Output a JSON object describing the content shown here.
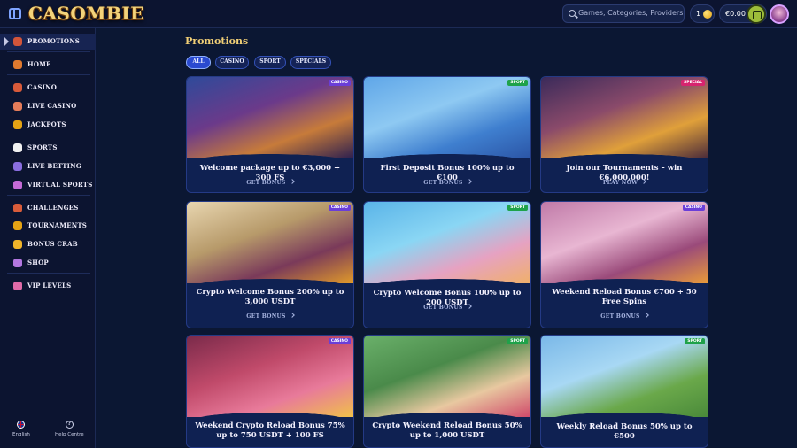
{
  "app": {
    "logo": "CASOMBIE"
  },
  "header": {
    "search_placeholder": "Games, Categories, Providers",
    "coins": "1",
    "balance": "€0.00"
  },
  "sidebar": {
    "items": [
      {
        "label": "PROMOTIONS",
        "icon": "gift-icon",
        "color": "#d2553a"
      },
      {
        "label": "HOME",
        "icon": "home-icon",
        "color": "#e07a2f"
      },
      {
        "label": "CASINO",
        "icon": "casino-icon",
        "color": "#d85a3a"
      },
      {
        "label": "LIVE CASINO",
        "icon": "live-casino-icon",
        "color": "#e47c5a"
      },
      {
        "label": "JACKPOTS",
        "icon": "clover-icon",
        "color": "#e5a314"
      },
      {
        "label": "SPORTS",
        "icon": "ball-icon",
        "color": "#f1f1f1"
      },
      {
        "label": "LIVE BETTING",
        "icon": "live-betting-icon",
        "color": "#8a6ee0"
      },
      {
        "label": "VIRTUAL SPORTS",
        "icon": "gamepad-icon",
        "color": "#c46ad6"
      },
      {
        "label": "CHALLENGES",
        "icon": "challenges-icon",
        "color": "#d95c3a"
      },
      {
        "label": "TOURNAMENTS",
        "icon": "trophy-icon",
        "color": "#e5a314"
      },
      {
        "label": "BONUS CRAB",
        "icon": "crab-icon",
        "color": "#f0b42a"
      },
      {
        "label": "SHOP",
        "icon": "shop-icon",
        "color": "#b377e0"
      },
      {
        "label": "VIP LEVELS",
        "icon": "gem-icon",
        "color": "#e06aa8"
      }
    ],
    "footer": {
      "language": "English",
      "help": "Help Centre"
    }
  },
  "main": {
    "title": "Promotions",
    "filters": [
      "ALL",
      "CASINO",
      "SPORT",
      "SPECIALS"
    ],
    "cards": [
      {
        "title": "Welcome package up to €3,000 + 300 FS",
        "cta": "GET BONUS",
        "badge": "CASINO",
        "art": "casino-family-art"
      },
      {
        "title": "First Deposit Bonus 100% up to €100",
        "cta": "GET BONUS",
        "badge": "SPORT",
        "art": "sport-kick-art"
      },
      {
        "title": "Join our Tournaments – win €6,000,000!",
        "cta": "PLAY NOW",
        "badge": "SPECIAL",
        "art": "tournament-art"
      },
      {
        "title": "Crypto Welcome Bonus 200% up to 3,000 USDT",
        "cta": "GET BONUS",
        "badge": "CASINO",
        "art": "crypto-chest-art"
      },
      {
        "title": "Crypto Welcome Bonus 100% up to 200 USDT",
        "cta": "GET BONUS",
        "badge": "SPORT",
        "art": "crypto-run-art"
      },
      {
        "title": "Weekend Reload Bonus €700 + 50 Free Spins",
        "cta": "GET BONUS",
        "badge": "CASINO",
        "art": "bath-art"
      },
      {
        "title": "Weekend Crypto Reload Bonus 75% up to 750 USDT + 100 FS",
        "cta": "",
        "badge": "CASINO",
        "art": "candles-art"
      },
      {
        "title": "Crypto Weekend Reload Bonus 50% up to 1,000 USDT",
        "cta": "",
        "badge": "SPORT",
        "art": "dice-art"
      },
      {
        "title": "Weekly Reload Bonus 50% up to €500",
        "cta": "",
        "badge": "SPORT",
        "art": "field-art"
      }
    ]
  }
}
